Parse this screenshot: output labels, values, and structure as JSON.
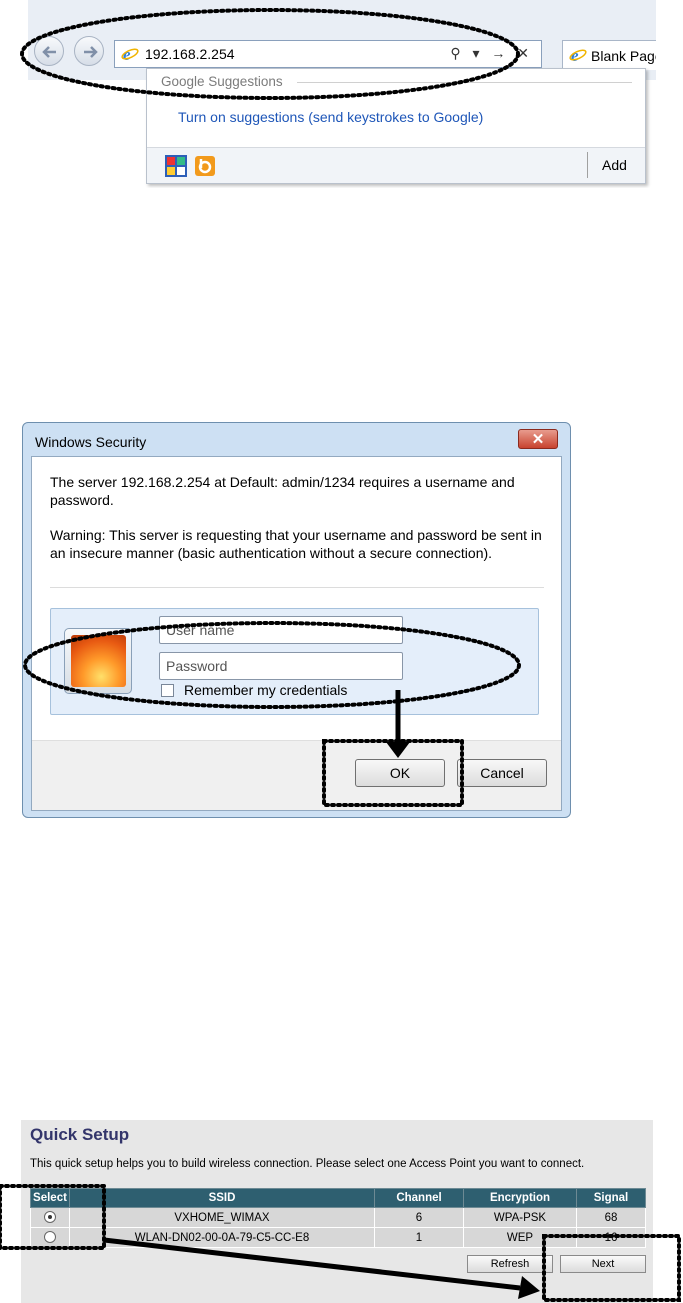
{
  "browser": {
    "url": "192.168.2.254",
    "tab_label": "Blank Page",
    "tool_glyphs": "⚲ ▾ → ✕",
    "suggestions_header": "Google Suggestions",
    "suggestions_link": "Turn on suggestions (send keystrokes to Google)",
    "add_label": "Add"
  },
  "dialog": {
    "title": "Windows Security",
    "close_glyph": "✕",
    "message_1": "The server 192.168.2.254 at Default: admin/1234 requires a username and password.",
    "message_2": "Warning: This server is requesting that your username and password be sent in an insecure manner (basic authentication without a secure connection).",
    "username_placeholder": "User name",
    "password_placeholder": "Password",
    "remember_label": "Remember my credentials",
    "ok_label": "OK",
    "cancel_label": "Cancel"
  },
  "quick_setup": {
    "title": "Quick Setup",
    "description": "This quick setup helps you to build wireless connection. Please select one Access Point you want to connect.",
    "columns": [
      "Select",
      "SSID",
      "Channel",
      "Encryption",
      "Signal"
    ],
    "rows": [
      {
        "selected": true,
        "ssid": "VXHOME_WIMAX",
        "channel": "6",
        "encryption": "WPA-PSK",
        "signal": "68"
      },
      {
        "selected": false,
        "ssid": "WLAN-DN02-00-0A-79-C5-CC-E8",
        "channel": "1",
        "encryption": "WEP",
        "signal": "16"
      }
    ],
    "refresh_label": "Refresh",
    "next_label": "Next"
  }
}
